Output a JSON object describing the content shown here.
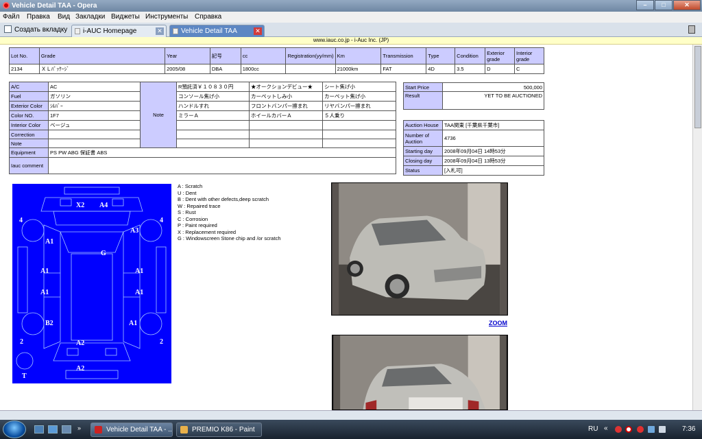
{
  "window": {
    "title": "Vehicle Detail TAA - Opera"
  },
  "menu": [
    "Файл",
    "Правка",
    "Вид",
    "Закладки",
    "Виджеты",
    "Инструменты",
    "Справка"
  ],
  "tabs": {
    "new_tab_label": "Создать вкладку",
    "items": [
      {
        "label": "i-AUC Homepage",
        "active": false
      },
      {
        "label": "Vehicle Detail TAA",
        "active": true
      }
    ]
  },
  "page_header": "www.iauc.co.jp  -  i-Auc Inc. (JP)",
  "lot_table": {
    "headers": [
      "Lot No.",
      "Grade",
      "Year",
      "記号",
      "cc",
      "Registration(yy/mm)",
      "Km",
      "Transmission",
      "Type",
      "Condition",
      "Exterior grade",
      "Interior grade"
    ],
    "values": [
      "2134",
      "ＸＬﾊﾟｯｹｰｼﾞ",
      "2005/08",
      "DBA",
      "1800cc",
      "",
      "21000km",
      "FAT",
      "4D",
      "3.5",
      "D",
      "C"
    ]
  },
  "spec_table": {
    "note_label": "Note",
    "rows": [
      {
        "label": "A/C",
        "value": "AC"
      },
      {
        "label": "Fuel",
        "value": "ガソリン"
      },
      {
        "label": "Exterior Color",
        "value": "ｼﾙﾊﾞｰ"
      },
      {
        "label": "Color NO.",
        "value": "1F7"
      },
      {
        "label": "Interior Color",
        "value": "ベージュ"
      },
      {
        "label": "Correction",
        "value": ""
      },
      {
        "label": "Note",
        "value": ""
      }
    ],
    "notes": [
      [
        "R預託済￥１０８３０円",
        "★オークションデビュー★",
        "シート焦げ小"
      ],
      [
        "コンソール焦げ小",
        "カーペットしみ小",
        "カーペット焦げ小"
      ],
      [
        "ハンドルすれ",
        "フロントバンパー擦まれ",
        "リヤバンパー擦まれ"
      ],
      [
        "ミラーＡ",
        "ホイールカバーＡ",
        "５人乗り"
      ],
      [
        "",
        "",
        ""
      ],
      [
        "",
        "",
        ""
      ],
      [
        "",
        "",
        ""
      ]
    ],
    "equipment_label": "Equipment",
    "equipment_value": "PS PW ABG 保証書 ABS",
    "comment_label": "Iauc comment",
    "comment_value": ""
  },
  "price_table": {
    "start_price_label": "Start Price",
    "start_price": "500,000",
    "result_label": "Result",
    "result": "YET TO BE AUCTIONED"
  },
  "auction_table": {
    "rows": [
      {
        "label": "Auction House",
        "value": "TAA関東 [千葉県千葉市]"
      },
      {
        "label": "Number of Auction",
        "value": "4736"
      },
      {
        "label": "Starting day",
        "value": "2008年09月04日 14時53分"
      },
      {
        "label": "Closing day",
        "value": "2008年09月04日 13時53分"
      },
      {
        "label": "Status",
        "value": "[入札可]"
      }
    ]
  },
  "legend": [
    "A  : Scratch",
    "U  : Dent",
    "B  : Dent with other defects,deep scratch",
    "W  : Repaired trace",
    "S  : Rust",
    "C  : Corrosion",
    "P  : Paint required",
    "X  : Replacement required",
    "G  : Windowscreen Stone chip and /or scratch"
  ],
  "diagram_marks": [
    "X2",
    "A4",
    "4",
    "4",
    "A1",
    "A3",
    "G",
    "A1",
    "A1",
    "A1",
    "A1",
    "B2",
    "A1",
    "2",
    "2",
    "A2",
    "T",
    "A2"
  ],
  "zoom_label": "ZOOM",
  "taskbar": {
    "tasks": [
      "Vehicle Detail TAA - ...",
      "PREMIO K86 - Paint"
    ],
    "lang": "RU",
    "clock": "7:36"
  },
  "colors": {
    "label_bg": "#ccccff",
    "diagram_bg": "#0000ff",
    "titlebar": "#6f87a3"
  }
}
